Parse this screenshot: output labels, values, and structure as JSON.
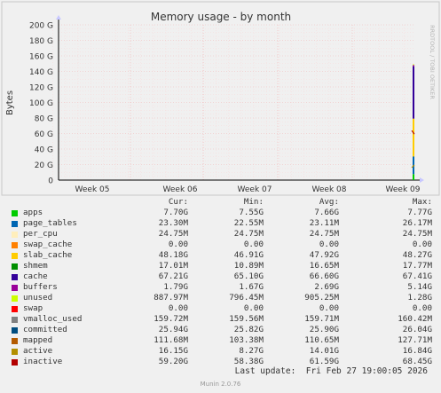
{
  "chart_data": {
    "type": "line",
    "title": "Memory usage - by month",
    "ylabel": "Bytes",
    "side_label": "RRDTOOL / TOBI OETIKER",
    "x_labels": [
      "Week 05",
      "Week 06",
      "Week 07",
      "Week 08",
      "Week 09"
    ],
    "y_ticks": [
      "0",
      "20 G",
      "40 G",
      "60 G",
      "80 G",
      "100 G",
      "120 G",
      "140 G",
      "160 G",
      "180 G",
      "200 G"
    ],
    "ylim": [
      0,
      200
    ],
    "y_unit": "G",
    "grid": true,
    "end_stack_G": [
      {
        "name": "apps",
        "value": 7.7,
        "color": "#00cc00"
      },
      {
        "name": "page_tables",
        "value": 23.3,
        "color": "#0066b3"
      },
      {
        "name": "per_cpu",
        "value": 0.025,
        "color": "#ffcc00"
      },
      {
        "name": "swap_cache",
        "value": 0,
        "color": "#ff8000"
      },
      {
        "name": "slab_cache",
        "value": 48.18,
        "color": "#ffcc00"
      },
      {
        "name": "cache",
        "value": 67.21,
        "color": "#330099"
      },
      {
        "name": "buffers",
        "value": 1.79,
        "color": "#990099"
      },
      {
        "name": "unused",
        "value": 0.888,
        "color": "#ccff00"
      }
    ],
    "inactive_end_G": 59.2,
    "active_end_G": 16.15
  },
  "legend": {
    "headers": {
      "cur": "Cur:",
      "min": "Min:",
      "avg": "Avg:",
      "max": "Max:"
    },
    "rows": [
      {
        "name": "apps",
        "color": "#00cc00",
        "cur": "7.70G",
        "min": "7.55G",
        "avg": "7.66G",
        "max": "7.77G"
      },
      {
        "name": "page_tables",
        "color": "#0066b3",
        "cur": "23.30M",
        "min": "22.55M",
        "avg": "23.11M",
        "max": "26.17M"
      },
      {
        "name": "per_cpu",
        "color": "#ffeebb",
        "cur": "24.75M",
        "min": "24.75M",
        "avg": "24.75M",
        "max": "24.75M"
      },
      {
        "name": "swap_cache",
        "color": "#ff8000",
        "cur": "0.00",
        "min": "0.00",
        "avg": "0.00",
        "max": "0.00"
      },
      {
        "name": "slab_cache",
        "color": "#ffcc00",
        "cur": "48.18G",
        "min": "46.91G",
        "avg": "47.92G",
        "max": "48.27G"
      },
      {
        "name": "shmem",
        "color": "#008f00",
        "cur": "17.01M",
        "min": "10.89M",
        "avg": "16.65M",
        "max": "17.77M"
      },
      {
        "name": "cache",
        "color": "#330099",
        "cur": "67.21G",
        "min": "65.10G",
        "avg": "66.60G",
        "max": "67.41G"
      },
      {
        "name": "buffers",
        "color": "#990099",
        "cur": "1.79G",
        "min": "1.67G",
        "avg": "2.69G",
        "max": "5.14G"
      },
      {
        "name": "unused",
        "color": "#ccff00",
        "cur": "887.97M",
        "min": "796.45M",
        "avg": "905.25M",
        "max": "1.28G"
      },
      {
        "name": "swap",
        "color": "#ff0000",
        "cur": "0.00",
        "min": "0.00",
        "avg": "0.00",
        "max": "0.00"
      },
      {
        "name": "vmalloc_used",
        "color": "#808080",
        "cur": "159.72M",
        "min": "159.56M",
        "avg": "159.71M",
        "max": "160.42M"
      },
      {
        "name": "committed",
        "color": "#004d80",
        "cur": "25.94G",
        "min": "25.82G",
        "avg": "25.90G",
        "max": "26.04G"
      },
      {
        "name": "mapped",
        "color": "#b35a00",
        "cur": "111.68M",
        "min": "103.38M",
        "avg": "110.65M",
        "max": "127.71M"
      },
      {
        "name": "active",
        "color": "#b38f00",
        "cur": "16.15G",
        "min": "8.27G",
        "avg": "14.01G",
        "max": "16.84G"
      },
      {
        "name": "inactive",
        "color": "#b30000",
        "cur": "59.20G",
        "min": "58.38G",
        "avg": "61.59G",
        "max": "68.45G"
      }
    ]
  },
  "footer": {
    "last_update": "Last update:  Fri Feb 27 19:00:05 2026"
  },
  "version": "Munin 2.0.76"
}
